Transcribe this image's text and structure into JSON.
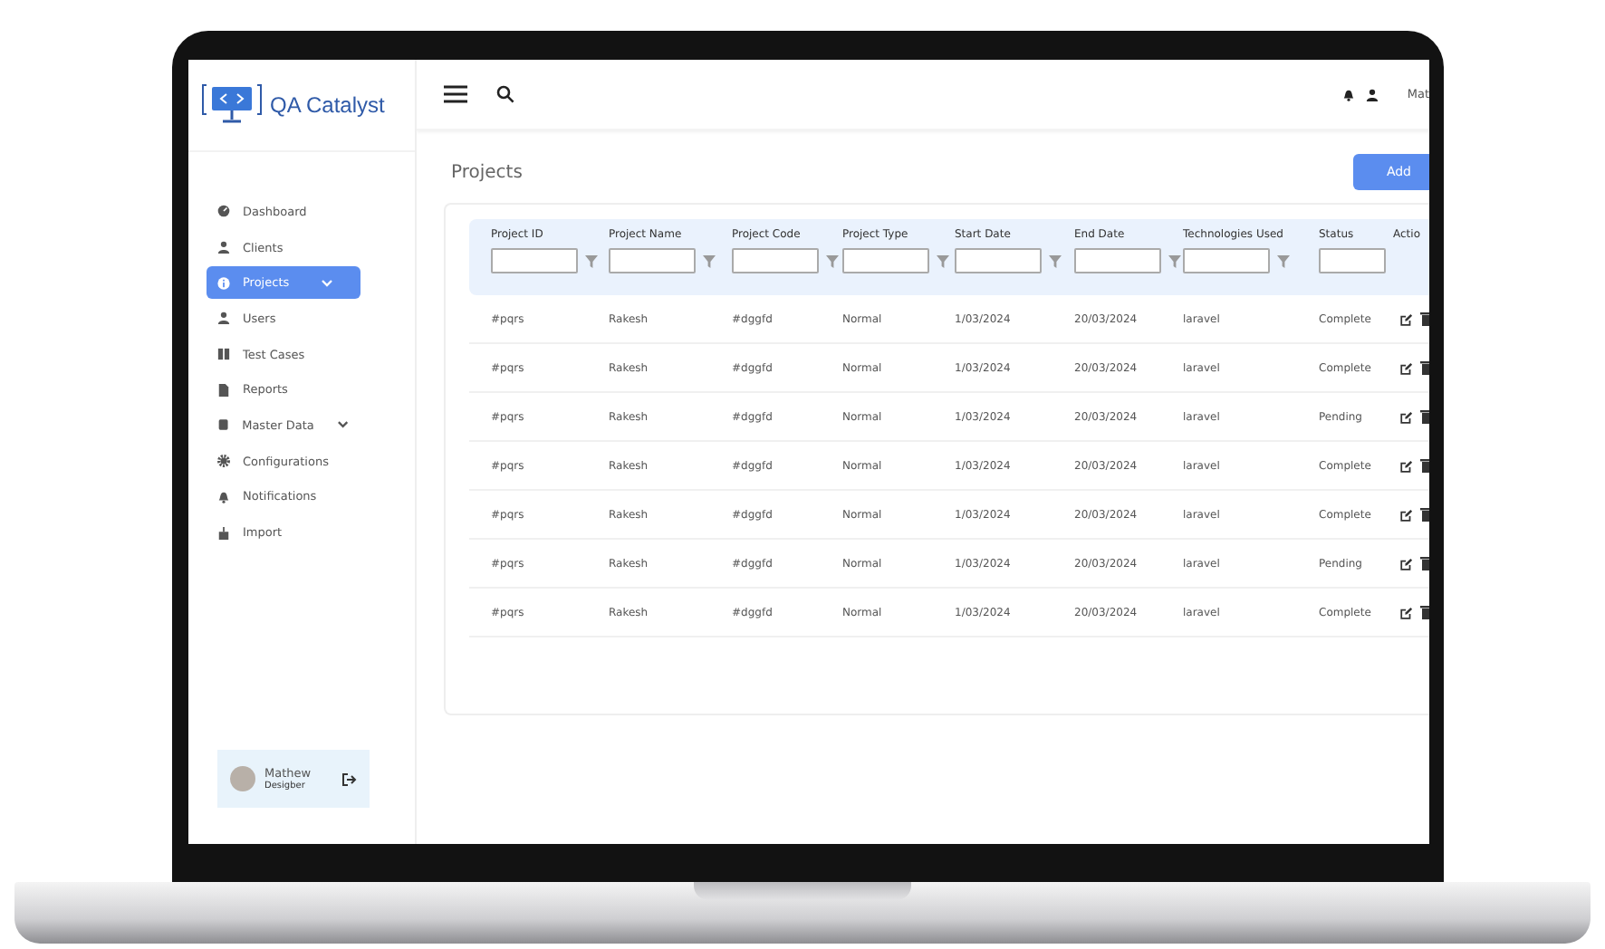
{
  "brand": {
    "name": "QA Catalyst"
  },
  "sidebar": {
    "items": [
      {
        "label": "Dashboard",
        "kind": "dashboard",
        "selected": false,
        "chevron": false
      },
      {
        "label": "Clients",
        "kind": "user",
        "selected": false,
        "chevron": false
      },
      {
        "label": "Projects",
        "kind": "info",
        "selected": true,
        "chevron": true
      },
      {
        "label": "Users",
        "kind": "user",
        "selected": false,
        "chevron": false
      },
      {
        "label": "Test Cases",
        "kind": "tests",
        "selected": false,
        "chevron": false
      },
      {
        "label": "Reports",
        "kind": "file",
        "selected": false,
        "chevron": false
      },
      {
        "label": "Master Data",
        "kind": "db",
        "selected": false,
        "chevron": true
      },
      {
        "label": "Configurations",
        "kind": "gear",
        "selected": false,
        "chevron": false
      },
      {
        "label": "Notifications",
        "kind": "bell",
        "selected": false,
        "chevron": false
      },
      {
        "label": "Import",
        "kind": "import",
        "selected": false,
        "chevron": false
      }
    ]
  },
  "user_card": {
    "name": "Mathew",
    "role": "Desigber"
  },
  "topbar": {
    "user_name": "Mat"
  },
  "page": {
    "title": "Projects",
    "add_button": "Add"
  },
  "table": {
    "columns": [
      {
        "label": "Project ID",
        "field": true,
        "filter": true
      },
      {
        "label": "Project Name",
        "field": true,
        "filter": true
      },
      {
        "label": "Project Code",
        "field": true,
        "filter": true
      },
      {
        "label": "Project Type",
        "field": true,
        "filter": true
      },
      {
        "label": "Start Date",
        "field": true,
        "filter": true
      },
      {
        "label": "End Date",
        "field": true,
        "filter": true
      },
      {
        "label": "Technologies Used",
        "field": true,
        "filter": true
      },
      {
        "label": "Status",
        "field": true,
        "filter": false
      },
      {
        "label": "Actio",
        "field": false,
        "filter": false
      }
    ],
    "rows": [
      [
        "#pqrs",
        "Rakesh",
        "#dggfd",
        "Normal",
        "1/03/2024",
        "20/03/2024",
        "laravel",
        "Complete"
      ],
      [
        "#pqrs",
        "Rakesh",
        "#dggfd",
        "Normal",
        "1/03/2024",
        "20/03/2024",
        "laravel",
        "Complete"
      ],
      [
        "#pqrs",
        "Rakesh",
        "#dggfd",
        "Normal",
        "1/03/2024",
        "20/03/2024",
        "laravel",
        "Pending"
      ],
      [
        "#pqrs",
        "Rakesh",
        "#dggfd",
        "Normal",
        "1/03/2024",
        "20/03/2024",
        "laravel",
        "Complete"
      ],
      [
        "#pqrs",
        "Rakesh",
        "#dggfd",
        "Normal",
        "1/03/2024",
        "20/03/2024",
        "laravel",
        "Complete"
      ],
      [
        "#pqrs",
        "Rakesh",
        "#dggfd",
        "Normal",
        "1/03/2024",
        "20/03/2024",
        "laravel",
        "Pending"
      ],
      [
        "#pqrs",
        "Rakesh",
        "#dggfd",
        "Normal",
        "1/03/2024",
        "20/03/2024",
        "laravel",
        "Complete"
      ]
    ]
  }
}
